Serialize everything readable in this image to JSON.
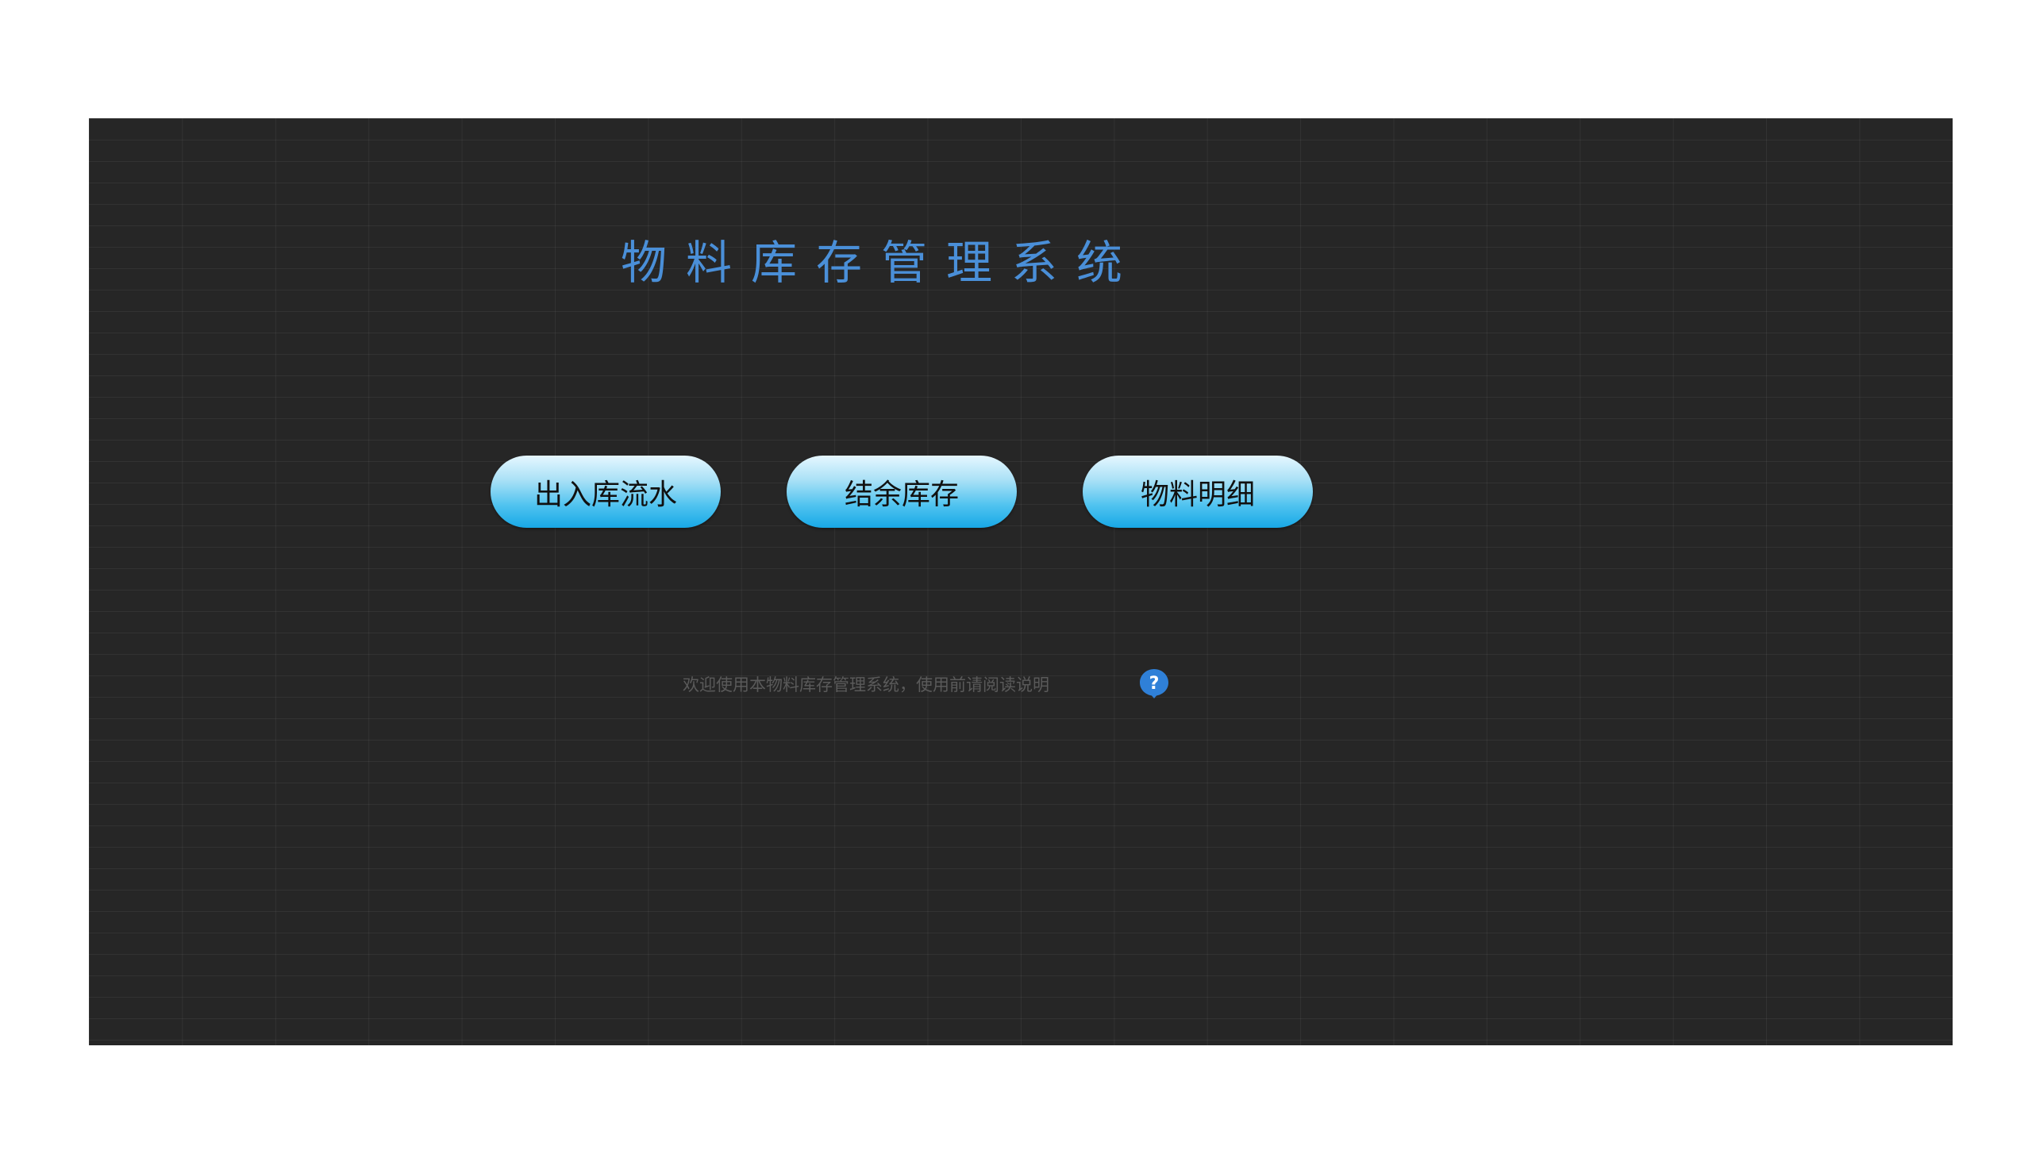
{
  "app": {
    "title": "物料库存管理系统"
  },
  "nav": {
    "buttons": [
      {
        "label": "出入库流水"
      },
      {
        "label": "结余库存"
      },
      {
        "label": "物料明细"
      }
    ]
  },
  "footer": {
    "welcome_text": "欢迎使用本物料库存管理系统，使用前请阅读说明",
    "help_icon": "question-mark-icon"
  },
  "colors": {
    "sheet_background": "#262626",
    "title": "#4a8fd8",
    "button_gradient_top": "#e6f7ff",
    "button_gradient_bottom": "#18a8e6",
    "help_icon": "#2f80d8"
  }
}
